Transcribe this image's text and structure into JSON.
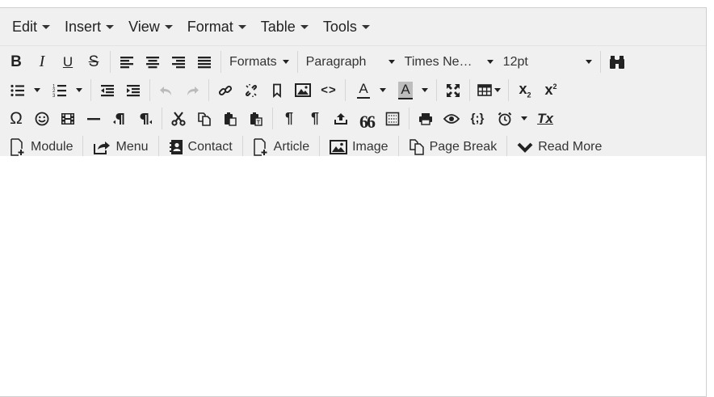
{
  "menubar": {
    "items": [
      {
        "label": "Edit"
      },
      {
        "label": "Insert"
      },
      {
        "label": "View"
      },
      {
        "label": "Format"
      },
      {
        "label": "Table"
      },
      {
        "label": "Tools"
      }
    ]
  },
  "toolbar": {
    "formats_label": "Formats",
    "block_format": "Paragraph",
    "font_family": "Times Ne…",
    "font_size": "12pt",
    "bold_glyph": "B",
    "italic_glyph": "I",
    "underline_glyph": "U",
    "strike_glyph": "S",
    "omega_glyph": "Ω",
    "pilcrow_glyph": "¶",
    "quote_glyph": "66",
    "code_glyph": "<>",
    "braces_glyph": "{;}",
    "text_color_glyph": "A",
    "bg_color_glyph": "A",
    "subscript_glyph": "x",
    "superscript_glyph": "x",
    "sub_mark": "2",
    "sup_mark": "2",
    "clear_glyph": "Tx"
  },
  "addons": {
    "items": [
      {
        "label": "Module",
        "icon": "file-plus-icon"
      },
      {
        "label": "Menu",
        "icon": "share-icon"
      },
      {
        "label": "Contact",
        "icon": "address-book-icon"
      },
      {
        "label": "Article",
        "icon": "file-plus-icon"
      },
      {
        "label": "Image",
        "icon": "image-icon"
      },
      {
        "label": "Page Break",
        "icon": "copy-icon"
      },
      {
        "label": "Read More",
        "icon": "chevron-down-icon"
      }
    ]
  },
  "colors": {
    "toolbar_bg": "#f0f0f0",
    "text": "#222222",
    "separator": "#d6d6d6",
    "bg_color_swatch": "#bdbdbd"
  }
}
